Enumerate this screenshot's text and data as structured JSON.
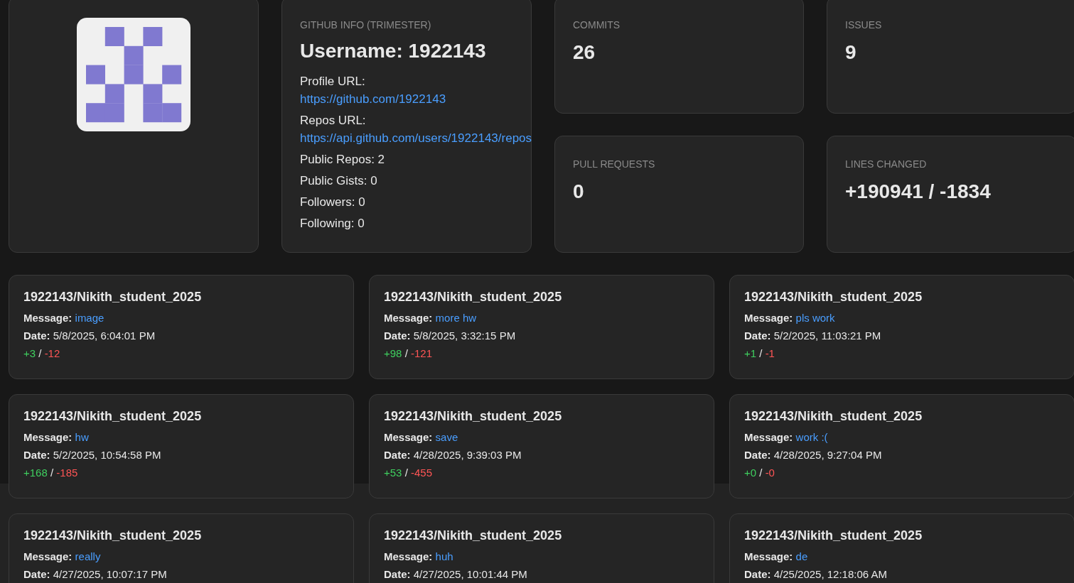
{
  "info": {
    "label": "GITHUB INFO (TRIMESTER)",
    "username": "Username: 1922143",
    "items": [
      {
        "kind": "label",
        "text": "Profile URL:"
      },
      {
        "kind": "link",
        "text": "https://github.com/1922143"
      },
      {
        "kind": "label",
        "text": "Repos URL:"
      },
      {
        "kind": "link",
        "text": "https://api.github.com/users/1922143/repos"
      },
      {
        "kind": "label",
        "text": "Public Repos: 2"
      },
      {
        "kind": "label",
        "text": "Public Gists: 0"
      },
      {
        "kind": "label",
        "text": "Followers: 0"
      },
      {
        "kind": "label",
        "text": "Following: 0"
      }
    ]
  },
  "stats": [
    {
      "label": "COMMITS",
      "value": "26"
    },
    {
      "label": "ISSUES",
      "value": "9"
    },
    {
      "label": "PULL REQUESTS",
      "value": "0"
    },
    {
      "label": "LINES CHANGED",
      "value": "+190941 / -1834"
    }
  ],
  "commits": [
    {
      "repo": "1922143/Nikith_student_2025",
      "message_label": "Message:",
      "message": "image",
      "date_label": "Date:",
      "date": "5/8/2025, 6:04:01 PM",
      "additions": "+3",
      "separator": "/",
      "deletions": "-12"
    },
    {
      "repo": "1922143/Nikith_student_2025",
      "message_label": "Message:",
      "message": "more hw",
      "date_label": "Date:",
      "date": "5/8/2025, 3:32:15 PM",
      "additions": "+98",
      "separator": "/",
      "deletions": "-121"
    },
    {
      "repo": "1922143/Nikith_student_2025",
      "message_label": "Message:",
      "message": "pls work",
      "date_label": "Date:",
      "date": "5/2/2025, 11:03:21 PM",
      "additions": "+1",
      "separator": "/",
      "deletions": "-1"
    },
    {
      "repo": "1922143/Nikith_student_2025",
      "message_label": "Message:",
      "message": "hw",
      "date_label": "Date:",
      "date": "5/2/2025, 10:54:58 PM",
      "additions": "+168",
      "separator": "/",
      "deletions": "-185"
    },
    {
      "repo": "1922143/Nikith_student_2025",
      "message_label": "Message:",
      "message": "save",
      "date_label": "Date:",
      "date": "4/28/2025, 9:39:03 PM",
      "additions": "+53",
      "separator": "/",
      "deletions": "-455"
    },
    {
      "repo": "1922143/Nikith_student_2025",
      "message_label": "Message:",
      "message": "work :(",
      "date_label": "Date:",
      "date": "4/28/2025, 9:27:04 PM",
      "additions": "+0",
      "separator": "/",
      "deletions": "-0"
    },
    {
      "repo": "1922143/Nikith_student_2025",
      "message_label": "Message:",
      "message": "really",
      "date_label": "Date:",
      "date": "4/27/2025, 10:07:17 PM"
    },
    {
      "repo": "1922143/Nikith_student_2025",
      "message_label": "Message:",
      "message": "huh",
      "date_label": "Date:",
      "date": "4/27/2025, 10:01:44 PM"
    },
    {
      "repo": "1922143/Nikith_student_2025",
      "message_label": "Message:",
      "message": "de",
      "date_label": "Date:",
      "date": "4/25/2025, 12:18:06 AM"
    }
  ]
}
